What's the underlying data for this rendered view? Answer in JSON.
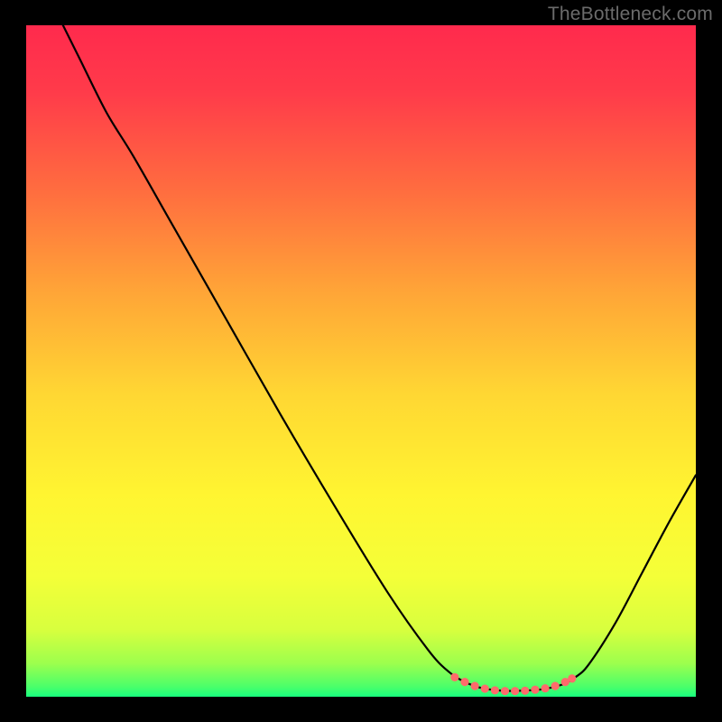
{
  "watermark": "TheBottleneck.com",
  "colors": {
    "bg": "#000000",
    "watermark": "#6b6b6b",
    "curve": "#000000",
    "marker_fill": "#ff6b6b",
    "marker_stroke": "#e05555",
    "gradient_stops": [
      {
        "offset": 0.0,
        "color": "#ff2a4d"
      },
      {
        "offset": 0.1,
        "color": "#ff3b4a"
      },
      {
        "offset": 0.25,
        "color": "#ff6e3f"
      },
      {
        "offset": 0.4,
        "color": "#ffa637"
      },
      {
        "offset": 0.55,
        "color": "#ffd733"
      },
      {
        "offset": 0.7,
        "color": "#fff531"
      },
      {
        "offset": 0.82,
        "color": "#f4ff38"
      },
      {
        "offset": 0.9,
        "color": "#d8ff3e"
      },
      {
        "offset": 0.95,
        "color": "#9dff4d"
      },
      {
        "offset": 0.985,
        "color": "#4bff6a"
      },
      {
        "offset": 1.0,
        "color": "#18ff7e"
      }
    ]
  },
  "chart_data": {
    "type": "line",
    "title": "",
    "xlabel": "",
    "ylabel": "",
    "xlim": [
      0,
      100
    ],
    "ylim": [
      0,
      100
    ],
    "grid": false,
    "curve": [
      {
        "x": 5.5,
        "y": 100
      },
      {
        "x": 8,
        "y": 95
      },
      {
        "x": 12,
        "y": 87
      },
      {
        "x": 16,
        "y": 80.5
      },
      {
        "x": 22,
        "y": 70
      },
      {
        "x": 30,
        "y": 56
      },
      {
        "x": 38,
        "y": 42
      },
      {
        "x": 46,
        "y": 28.5
      },
      {
        "x": 54,
        "y": 15.5
      },
      {
        "x": 60,
        "y": 7
      },
      {
        "x": 63,
        "y": 3.8
      },
      {
        "x": 65.5,
        "y": 2.2
      },
      {
        "x": 68,
        "y": 1.3
      },
      {
        "x": 71,
        "y": 0.9
      },
      {
        "x": 74,
        "y": 0.9
      },
      {
        "x": 77,
        "y": 1.1
      },
      {
        "x": 80,
        "y": 1.8
      },
      {
        "x": 82,
        "y": 2.9
      },
      {
        "x": 84,
        "y": 4.8
      },
      {
        "x": 88,
        "y": 11
      },
      {
        "x": 92,
        "y": 18.5
      },
      {
        "x": 96,
        "y": 26
      },
      {
        "x": 100,
        "y": 33
      }
    ],
    "markers": [
      {
        "x": 64.0,
        "y": 2.9
      },
      {
        "x": 65.5,
        "y": 2.2
      },
      {
        "x": 67.0,
        "y": 1.6
      },
      {
        "x": 68.5,
        "y": 1.2
      },
      {
        "x": 70.0,
        "y": 0.95
      },
      {
        "x": 71.5,
        "y": 0.85
      },
      {
        "x": 73.0,
        "y": 0.85
      },
      {
        "x": 74.5,
        "y": 0.9
      },
      {
        "x": 76.0,
        "y": 1.05
      },
      {
        "x": 77.5,
        "y": 1.25
      },
      {
        "x": 79.0,
        "y": 1.6
      },
      {
        "x": 80.5,
        "y": 2.2
      },
      {
        "x": 81.5,
        "y": 2.7
      }
    ]
  }
}
